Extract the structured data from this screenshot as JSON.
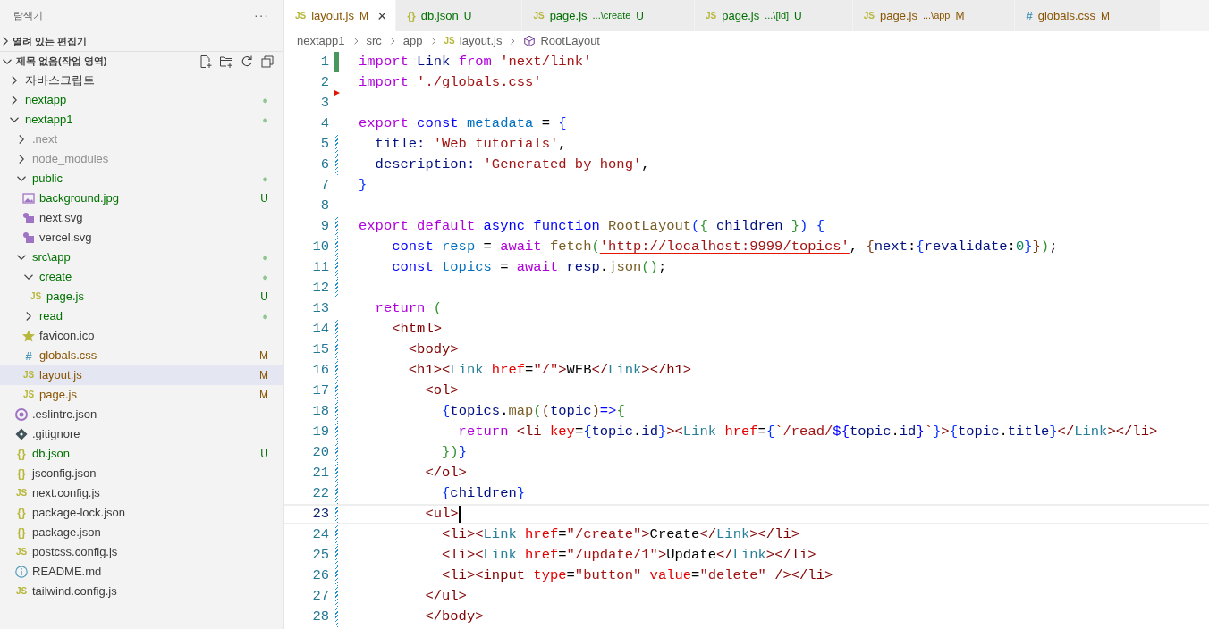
{
  "sidebar": {
    "title": "탐색기",
    "more": "···",
    "sections": [
      {
        "label": "열려 있는 편집기",
        "expanded": false
      },
      {
        "label": "제목 없음(작업 영역)",
        "expanded": true
      }
    ],
    "tree": [
      {
        "label": "자바스크립트",
        "kind": "folder",
        "expanded": false,
        "selected": false
      },
      {
        "label": "nextapp",
        "kind": "folder",
        "expanded": false,
        "color": "#007100",
        "badge": "●",
        "selected": false
      },
      {
        "label": "nextapp1",
        "kind": "folder",
        "expanded": true,
        "color": "#007100",
        "badge": "●",
        "selected": false,
        "children": [
          {
            "label": ".next",
            "kind": "folder",
            "expanded": false,
            "color": "#8e8e90",
            "selected": false
          },
          {
            "label": "node_modules",
            "kind": "folder",
            "expanded": false,
            "color": "#8e8e90",
            "selected": false
          },
          {
            "label": "public",
            "kind": "folder",
            "expanded": true,
            "color": "#007100",
            "badge": "●",
            "selected": false,
            "children": [
              {
                "label": "background.jpg",
                "kind": "image",
                "color": "#007100",
                "badge": "U",
                "selected": false
              },
              {
                "label": "next.svg",
                "kind": "svg",
                "selected": false
              },
              {
                "label": "vercel.svg",
                "kind": "svg",
                "selected": false
              }
            ]
          },
          {
            "label": "src\\app",
            "kind": "folder",
            "expanded": true,
            "color": "#007100",
            "badge": "●",
            "selected": false,
            "children": [
              {
                "label": "create",
                "kind": "folder",
                "expanded": true,
                "color": "#007100",
                "badge": "●",
                "selected": false,
                "children": [
                  {
                    "label": "page.js",
                    "kind": "js",
                    "icon": "JS",
                    "color": "#007100",
                    "badge": "U",
                    "selected": false
                  }
                ]
              },
              {
                "label": "read",
                "kind": "folder",
                "expanded": false,
                "color": "#007100",
                "badge": "●",
                "selected": false
              },
              {
                "label": "favicon.ico",
                "kind": "star",
                "selected": false
              },
              {
                "label": "globals.css",
                "kind": "css",
                "icon": "#",
                "color": "#895503",
                "badge": "M",
                "selected": false
              },
              {
                "label": "layout.js",
                "kind": "js",
                "icon": "JS",
                "color": "#895503",
                "badge": "M",
                "selected": true
              },
              {
                "label": "page.js",
                "kind": "js",
                "icon": "JS",
                "color": "#895503",
                "badge": "M",
                "selected": false
              }
            ]
          },
          {
            "label": ".eslintrc.json",
            "kind": "eslint",
            "selected": false
          },
          {
            "label": ".gitignore",
            "kind": "git",
            "selected": false
          },
          {
            "label": "db.json",
            "kind": "json",
            "icon": "{}",
            "color": "#007100",
            "badge": "U",
            "selected": false
          },
          {
            "label": "jsconfig.json",
            "kind": "json",
            "icon": "{}",
            "selected": false
          },
          {
            "label": "next.config.js",
            "kind": "js",
            "icon": "JS",
            "selected": false
          },
          {
            "label": "package-lock.json",
            "kind": "json",
            "icon": "{}",
            "selected": false
          },
          {
            "label": "package.json",
            "kind": "json",
            "icon": "{}",
            "selected": false
          },
          {
            "label": "postcss.config.js",
            "kind": "js",
            "icon": "JS",
            "selected": false
          },
          {
            "label": "README.md",
            "kind": "info",
            "selected": false
          },
          {
            "label": "tailwind.config.js",
            "kind": "js",
            "icon": "JS",
            "selected": false
          }
        ]
      }
    ]
  },
  "tabs": [
    {
      "label": "layout.js",
      "kind": "js",
      "icon": "JS",
      "color": "#895503",
      "badge": "M",
      "selected": true,
      "close": "×"
    },
    {
      "label": "db.json",
      "kind": "json",
      "icon": "{}",
      "color": "#007100",
      "badge": "U",
      "selected": false
    },
    {
      "label": "page.js",
      "description": "...\\create",
      "kind": "js",
      "icon": "JS",
      "color": "#007100",
      "badge": "U",
      "selected": false
    },
    {
      "label": "page.js",
      "description": "...\\[id]",
      "kind": "js",
      "icon": "JS",
      "color": "#007100",
      "badge": "U",
      "selected": false
    },
    {
      "label": "page.js",
      "description": "...\\app",
      "kind": "js",
      "icon": "JS",
      "color": "#895503",
      "badge": "M",
      "selected": false
    },
    {
      "label": "globals.css",
      "kind": "css",
      "icon": "#",
      "color": "#895503",
      "badge": "M",
      "selected": false
    }
  ],
  "breadcrumb": [
    {
      "label": "nextapp1",
      "kind": "folder"
    },
    {
      "label": "src",
      "kind": "folder"
    },
    {
      "label": "app",
      "kind": "folder"
    },
    {
      "label": "layout.js",
      "kind": "js",
      "icon": "JS"
    },
    {
      "label": "RootLayout",
      "kind": "symbol"
    }
  ],
  "editor": {
    "lines": [
      {
        "number": "1",
        "kind": "added",
        "tokens": [
          {
            "text": "import",
            "kind": "c"
          },
          {
            "text": " Link ",
            "kind": "v"
          },
          {
            "text": "from",
            "kind": "c"
          },
          {
            "text": " 'next/link'",
            "kind": "s"
          }
        ]
      },
      {
        "number": "2",
        "kind": "deleted",
        "tokens": [
          {
            "text": "import",
            "kind": "c"
          },
          {
            "text": " './globals.css'",
            "kind": "s"
          }
        ]
      },
      {
        "number": "3",
        "kind": "plain"
      },
      {
        "number": "4",
        "kind": "plain",
        "tokens": [
          {
            "text": "export",
            "kind": "c"
          },
          {
            "text": " const",
            "kind": "k"
          },
          {
            "text": " metadata",
            "kind": "v2"
          },
          {
            "text": " = ",
            "kind": "p"
          },
          {
            "text": "{",
            "kind": "b1"
          }
        ]
      },
      {
        "number": "5",
        "kind": "modified",
        "tokens": [
          {
            "text": "  title: ",
            "kind": "v"
          },
          {
            "text": "'Web tutorials'",
            "kind": "s"
          },
          {
            "text": ",",
            "kind": "p"
          }
        ]
      },
      {
        "number": "6",
        "kind": "modified",
        "tokens": [
          {
            "text": "  description: ",
            "kind": "v"
          },
          {
            "text": "'Generated by hong'",
            "kind": "s"
          },
          {
            "text": ",",
            "kind": "p"
          }
        ]
      },
      {
        "number": "7",
        "kind": "plain",
        "tokens": [
          {
            "text": "}",
            "kind": "b1"
          }
        ]
      },
      {
        "number": "8",
        "kind": "plain"
      },
      {
        "number": "9",
        "kind": "modified",
        "tokens": [
          {
            "text": "export",
            "kind": "c"
          },
          {
            "text": " default",
            "kind": "c"
          },
          {
            "text": " async",
            "kind": "k"
          },
          {
            "text": " function",
            "kind": "k"
          },
          {
            "text": " RootLayout",
            "kind": "f"
          },
          {
            "text": "(",
            "kind": "b1"
          },
          {
            "text": "{",
            "kind": "b2"
          },
          {
            "text": " children ",
            "kind": "v"
          },
          {
            "text": "}",
            "kind": "b2"
          },
          {
            "text": ")",
            "kind": "b1"
          },
          {
            "text": " {",
            "kind": "b1"
          }
        ]
      },
      {
        "number": "10",
        "kind": "modified",
        "tokens": [
          {
            "text": "    const",
            "kind": "k"
          },
          {
            "text": " resp",
            "kind": "v2"
          },
          {
            "text": " = ",
            "kind": "p"
          },
          {
            "text": "await",
            "kind": "c"
          },
          {
            "text": " fetch",
            "kind": "f"
          },
          {
            "text": "(",
            "kind": "b2"
          },
          {
            "text": "'http://localhost:9999/topics'",
            "kind": "u"
          },
          {
            "text": ", ",
            "kind": "p"
          },
          {
            "text": "{",
            "kind": "b3"
          },
          {
            "text": "next",
            "kind": "v"
          },
          {
            "text": ":",
            "kind": "p"
          },
          {
            "text": "{",
            "kind": "b1"
          },
          {
            "text": "revalidate",
            "kind": "v"
          },
          {
            "text": ":",
            "kind": "p"
          },
          {
            "text": "0",
            "kind": "n"
          },
          {
            "text": "}",
            "kind": "b1"
          },
          {
            "text": "}",
            "kind": "b3"
          },
          {
            "text": ")",
            "kind": "b2"
          },
          {
            "text": ";",
            "kind": "p"
          }
        ]
      },
      {
        "number": "11",
        "kind": "modified",
        "tokens": [
          {
            "text": "    const",
            "kind": "k"
          },
          {
            "text": " topics",
            "kind": "v2"
          },
          {
            "text": " = ",
            "kind": "p"
          },
          {
            "text": "await",
            "kind": "c"
          },
          {
            "text": " resp",
            "kind": "v"
          },
          {
            "text": ".",
            "kind": "p"
          },
          {
            "text": "json",
            "kind": "f"
          },
          {
            "text": "()",
            "kind": "b2"
          },
          {
            "text": ";",
            "kind": "p"
          }
        ]
      },
      {
        "number": "12",
        "kind": "modified"
      },
      {
        "number": "13",
        "kind": "plain",
        "tokens": [
          {
            "text": "  return",
            "kind": "c"
          },
          {
            "text": " (",
            "kind": "b2"
          }
        ]
      },
      {
        "number": "14",
        "kind": "modified",
        "tokens": [
          {
            "text": "    <html>",
            "kind": "t"
          }
        ]
      },
      {
        "number": "15",
        "kind": "modified",
        "tokens": [
          {
            "text": "      <body>",
            "kind": "t"
          }
        ]
      },
      {
        "number": "16",
        "kind": "modified",
        "tokens": [
          {
            "text": "      <h1><",
            "kind": "t"
          },
          {
            "text": "Link",
            "kind": "m"
          },
          {
            "text": " href",
            "kind": "a"
          },
          {
            "text": "=",
            "kind": "p"
          },
          {
            "text": "\"/\"",
            "kind": "s"
          },
          {
            "text": ">",
            "kind": "t"
          },
          {
            "text": "WEB",
            "kind": "p"
          },
          {
            "text": "</",
            "kind": "t"
          },
          {
            "text": "Link",
            "kind": "m"
          },
          {
            "text": "></h1>",
            "kind": "t"
          }
        ]
      },
      {
        "number": "17",
        "kind": "modified",
        "tokens": [
          {
            "text": "        <ol>",
            "kind": "t"
          }
        ]
      },
      {
        "number": "18",
        "kind": "modified",
        "tokens": [
          {
            "text": "          {",
            "kind": "b1"
          },
          {
            "text": "topics",
            "kind": "v"
          },
          {
            "text": ".",
            "kind": "p"
          },
          {
            "text": "map",
            "kind": "f"
          },
          {
            "text": "(",
            "kind": "b2"
          },
          {
            "text": "(",
            "kind": "b3"
          },
          {
            "text": "topic",
            "kind": "v"
          },
          {
            "text": ")",
            "kind": "b3"
          },
          {
            "text": "=>",
            "kind": "k"
          },
          {
            "text": "{",
            "kind": "b2"
          }
        ]
      },
      {
        "number": "19",
        "kind": "modified",
        "tokens": [
          {
            "text": "            return",
            "kind": "c"
          },
          {
            "text": " <li",
            "kind": "t"
          },
          {
            "text": " key",
            "kind": "a"
          },
          {
            "text": "=",
            "kind": "p"
          },
          {
            "text": "{",
            "kind": "b1"
          },
          {
            "text": "topic",
            "kind": "v"
          },
          {
            "text": ".",
            "kind": "p"
          },
          {
            "text": "id",
            "kind": "v"
          },
          {
            "text": "}",
            "kind": "b1"
          },
          {
            "text": "><",
            "kind": "t"
          },
          {
            "text": "Link",
            "kind": "m"
          },
          {
            "text": " href",
            "kind": "a"
          },
          {
            "text": "=",
            "kind": "p"
          },
          {
            "text": "{",
            "kind": "b1"
          },
          {
            "text": "`/read/",
            "kind": "s"
          },
          {
            "text": "${",
            "kind": "k"
          },
          {
            "text": "topic",
            "kind": "v"
          },
          {
            "text": ".",
            "kind": "p"
          },
          {
            "text": "id",
            "kind": "v"
          },
          {
            "text": "}",
            "kind": "k"
          },
          {
            "text": "`",
            "kind": "s"
          },
          {
            "text": "}",
            "kind": "b1"
          },
          {
            "text": ">",
            "kind": "t"
          },
          {
            "text": "{",
            "kind": "b1"
          },
          {
            "text": "topic",
            "kind": "v"
          },
          {
            "text": ".",
            "kind": "p"
          },
          {
            "text": "title",
            "kind": "v"
          },
          {
            "text": "}",
            "kind": "b1"
          },
          {
            "text": "</",
            "kind": "t"
          },
          {
            "text": "Link",
            "kind": "m"
          },
          {
            "text": "></li>",
            "kind": "t"
          }
        ]
      },
      {
        "number": "20",
        "kind": "modified",
        "tokens": [
          {
            "text": "          }",
            "kind": "b2"
          },
          {
            "text": ")",
            "kind": "b2"
          },
          {
            "text": "}",
            "kind": "b1"
          }
        ]
      },
      {
        "number": "21",
        "kind": "modified",
        "tokens": [
          {
            "text": "        </ol>",
            "kind": "t"
          }
        ]
      },
      {
        "number": "22",
        "kind": "modified",
        "tokens": [
          {
            "text": "          {",
            "kind": "b1"
          },
          {
            "text": "children",
            "kind": "v"
          },
          {
            "text": "}",
            "kind": "b1"
          }
        ]
      },
      {
        "number": "23",
        "kind": "modified",
        "current": true,
        "tokens": [
          {
            "text": "        <ul>",
            "kind": "t"
          }
        ]
      },
      {
        "number": "24",
        "kind": "modified",
        "tokens": [
          {
            "text": "          <li><",
            "kind": "t"
          },
          {
            "text": "Link",
            "kind": "m"
          },
          {
            "text": " href",
            "kind": "a"
          },
          {
            "text": "=",
            "kind": "p"
          },
          {
            "text": "\"/create\"",
            "kind": "s"
          },
          {
            "text": ">",
            "kind": "t"
          },
          {
            "text": "Create",
            "kind": "p"
          },
          {
            "text": "</",
            "kind": "t"
          },
          {
            "text": "Link",
            "kind": "m"
          },
          {
            "text": "></li>",
            "kind": "t"
          }
        ]
      },
      {
        "number": "25",
        "kind": "modified",
        "tokens": [
          {
            "text": "          <li><",
            "kind": "t"
          },
          {
            "text": "Link",
            "kind": "m"
          },
          {
            "text": " href",
            "kind": "a"
          },
          {
            "text": "=",
            "kind": "p"
          },
          {
            "text": "\"/update/1\"",
            "kind": "s"
          },
          {
            "text": ">",
            "kind": "t"
          },
          {
            "text": "Update",
            "kind": "p"
          },
          {
            "text": "</",
            "kind": "t"
          },
          {
            "text": "Link",
            "kind": "m"
          },
          {
            "text": "></li>",
            "kind": "t"
          }
        ]
      },
      {
        "number": "26",
        "kind": "modified",
        "tokens": [
          {
            "text": "          <li><input",
            "kind": "t"
          },
          {
            "text": " type",
            "kind": "a"
          },
          {
            "text": "=",
            "kind": "p"
          },
          {
            "text": "\"button\"",
            "kind": "s"
          },
          {
            "text": " value",
            "kind": "a"
          },
          {
            "text": "=",
            "kind": "p"
          },
          {
            "text": "\"delete\"",
            "kind": "s"
          },
          {
            "text": " /></li>",
            "kind": "t"
          }
        ]
      },
      {
        "number": "27",
        "kind": "modified",
        "tokens": [
          {
            "text": "        </ul>",
            "kind": "t"
          }
        ]
      },
      {
        "number": "28",
        "kind": "modified",
        "tokens": [
          {
            "text": "        </body>",
            "kind": "t"
          }
        ]
      }
    ]
  }
}
